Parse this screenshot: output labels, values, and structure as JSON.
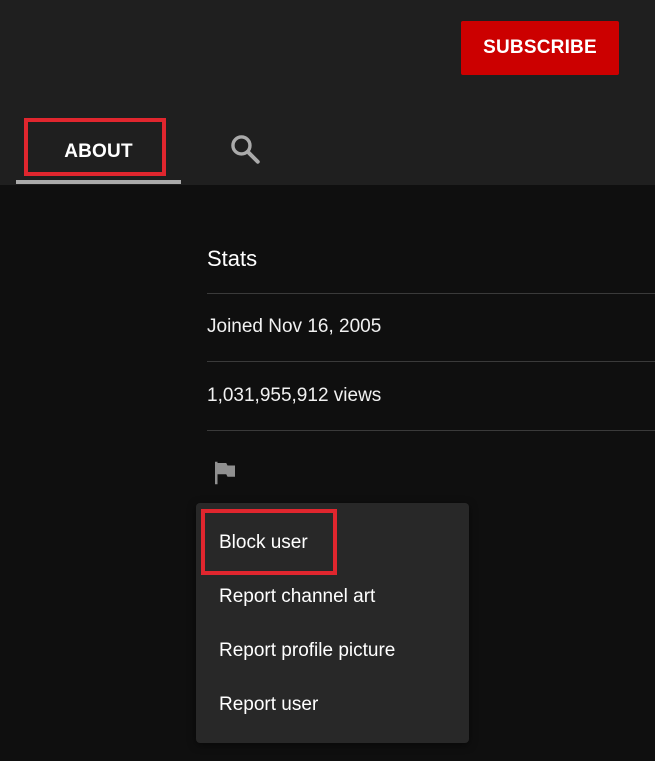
{
  "header": {
    "subscribe_label": "SUBSCRIBE",
    "tabs": [
      {
        "label": "ABOUT",
        "selected": true
      }
    ],
    "search_icon": "search-icon"
  },
  "about": {
    "stats_title": "Stats",
    "joined": "Joined Nov 16, 2005",
    "views": "1,031,955,912 views",
    "report_icon": "flag-icon"
  },
  "menu": {
    "items": [
      {
        "label": "Block user"
      },
      {
        "label": "Report channel art"
      },
      {
        "label": "Report profile picture"
      },
      {
        "label": "Report user"
      }
    ]
  },
  "colors": {
    "subscribe": "#cc0000",
    "highlight": "#e0262e",
    "header_bg": "#1f1f1f",
    "page_bg": "#0f0f0f",
    "menu_bg": "#282828"
  }
}
